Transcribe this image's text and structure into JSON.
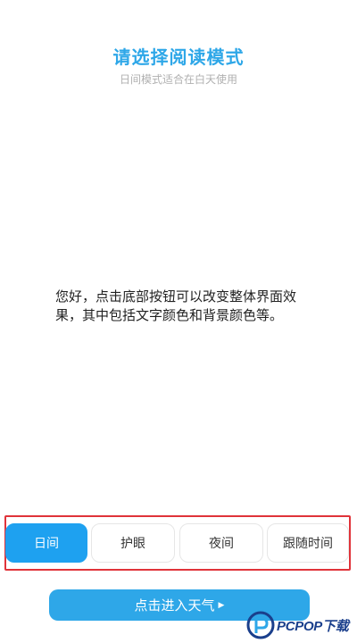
{
  "header": {
    "title": "请选择阅读模式",
    "subtitle": "日间模式适合在白天使用"
  },
  "content": {
    "description": "您好，点击底部按钮可以改变整体界面效果，其中包括文字颜色和背景颜色等。"
  },
  "modes": [
    {
      "label": "日间",
      "selected": true
    },
    {
      "label": "护眼",
      "selected": false
    },
    {
      "label": "夜间",
      "selected": false
    },
    {
      "label": "跟随时间",
      "selected": false
    }
  ],
  "enter_button": {
    "label": "点击进入天气",
    "icon": "caret-right-icon"
  },
  "watermark": {
    "brand": "PCPOP下载"
  },
  "colors": {
    "accent": "#2ea7e8",
    "selected_mode": "#1ea1f0",
    "highlight_frame": "#e0333a"
  }
}
